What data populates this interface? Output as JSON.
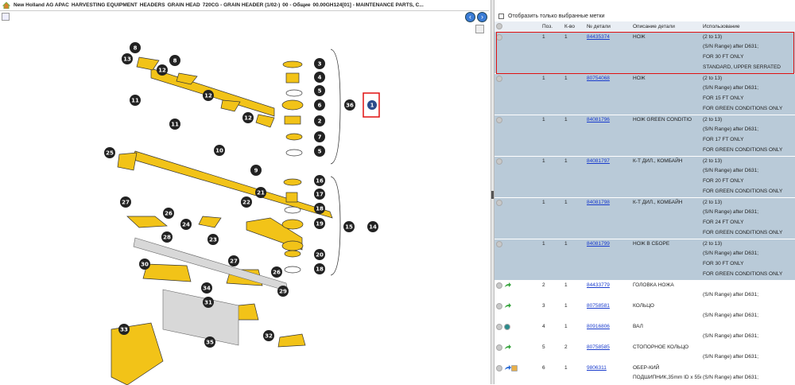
{
  "breadcrumb": [
    "New Holland AG APAC",
    "HARVESTING EQUIPMENT",
    "HEADERS",
    "GRAIN HEAD",
    "720CG - GRAIN HEADER (1/02-)",
    "00 - Общие",
    "00.00GH124[01] - MAINTENANCE PARTS, C..."
  ],
  "filter_label": "Отобразить только выбранные метки",
  "columns": [
    "Поз.",
    "К-во",
    "№ детали",
    "Описание детали",
    "Использование"
  ],
  "callouts": [
    "8",
    "13",
    "8",
    "12",
    "11",
    "12",
    "11",
    "12",
    "25",
    "10",
    "9",
    "27",
    "26",
    "24",
    "21",
    "22",
    "23",
    "28",
    "30",
    "27",
    "26",
    "34",
    "33",
    "31",
    "29",
    "35",
    "32",
    "3",
    "4",
    "5",
    "6",
    "2",
    "7",
    "5",
    "36",
    "16",
    "17",
    "18",
    "19",
    "20",
    "18",
    "15",
    "14",
    "1"
  ],
  "groups": [
    {
      "pos": "1",
      "qty": "1",
      "part": "84435374",
      "desc": "НОЖ",
      "usage": [
        "(2 to 13)",
        "(S/N Range) after D631;",
        "FOR 30 FT ONLY",
        "STANDARD, UPPER SERRATED"
      ],
      "selected": true,
      "icon": "grey"
    },
    {
      "pos": "1",
      "qty": "1",
      "part": "80754068",
      "desc": "НОЖ",
      "usage": [
        "(2 to 13)",
        "(S/N Range) after D631;",
        "FOR 15 FT ONLY",
        "FOR GREEN CONDITIONS ONLY"
      ],
      "selected": true,
      "icon": "grey"
    },
    {
      "pos": "1",
      "qty": "1",
      "part": "84081796",
      "desc": "НОЖ GREEN CONDITIO",
      "usage": [
        "(2 to 13)",
        "(S/N Range) after D631;",
        "FOR 17 FT ONLY",
        "FOR GREEN CONDITIONS ONLY"
      ],
      "selected": true,
      "icon": "grey"
    },
    {
      "pos": "1",
      "qty": "1",
      "part": "84081797",
      "desc": "К-Т ДИЛ., КОМБАЙН",
      "usage": [
        "(2 to 13)",
        "(S/N Range) after D631;",
        "FOR 20 FT ONLY",
        "FOR GREEN CONDITIONS ONLY"
      ],
      "selected": true,
      "icon": "grey"
    },
    {
      "pos": "1",
      "qty": "1",
      "part": "84081798",
      "desc": "К-Т ДИЛ., КОМБАЙН",
      "usage": [
        "(2 to 13)",
        "(S/N Range) after D631;",
        "FOR 24 FT ONLY",
        "FOR GREEN CONDITIONS ONLY"
      ],
      "selected": true,
      "icon": "grey"
    },
    {
      "pos": "1",
      "qty": "1",
      "part": "84081799",
      "desc": "НОЖ В СБОРЕ",
      "usage": [
        "(2 to 13)",
        "(S/N Range) after D631;",
        "FOR 30 FT ONLY",
        "FOR GREEN CONDITIONS ONLY"
      ],
      "selected": true,
      "icon": "grey"
    },
    {
      "pos": "2",
      "qty": "1",
      "part": "84433779",
      "desc": "ГОЛОВКА НОЖА",
      "usage": [
        "",
        "(S/N Range) after D631;"
      ],
      "selected": false,
      "icon": "green"
    },
    {
      "pos": "3",
      "qty": "1",
      "part": "80758581",
      "desc": "КОЛЬЦО",
      "usage": [
        "",
        "(S/N Range) after D631;"
      ],
      "selected": false,
      "icon": "green"
    },
    {
      "pos": "4",
      "qty": "1",
      "part": "80916806",
      "desc": "ВАЛ",
      "usage": [
        "",
        "(S/N Range) after D631;"
      ],
      "selected": false,
      "icon": "globe"
    },
    {
      "pos": "5",
      "qty": "2",
      "part": "80758585",
      "desc": "СТОПОРНОЕ КОЛЬЦО",
      "usage": [
        "",
        "(S/N Range) after D631;"
      ],
      "selected": false,
      "icon": "green"
    },
    {
      "pos": "6",
      "qty": "1",
      "part": "9806311",
      "desc": "ОБЕР-КИЙ",
      "usage": [
        "",
        "(S/N Range) after D631;"
      ],
      "extra": "ПОДШИПНИК,35mm ID x 55mm",
      "selected": false,
      "icon": "multi"
    }
  ],
  "colors": {
    "selected_row": "#b9cad8",
    "part_yellow": "#f2c318",
    "highlight": "#e01010",
    "link": "#1a3ccd"
  }
}
